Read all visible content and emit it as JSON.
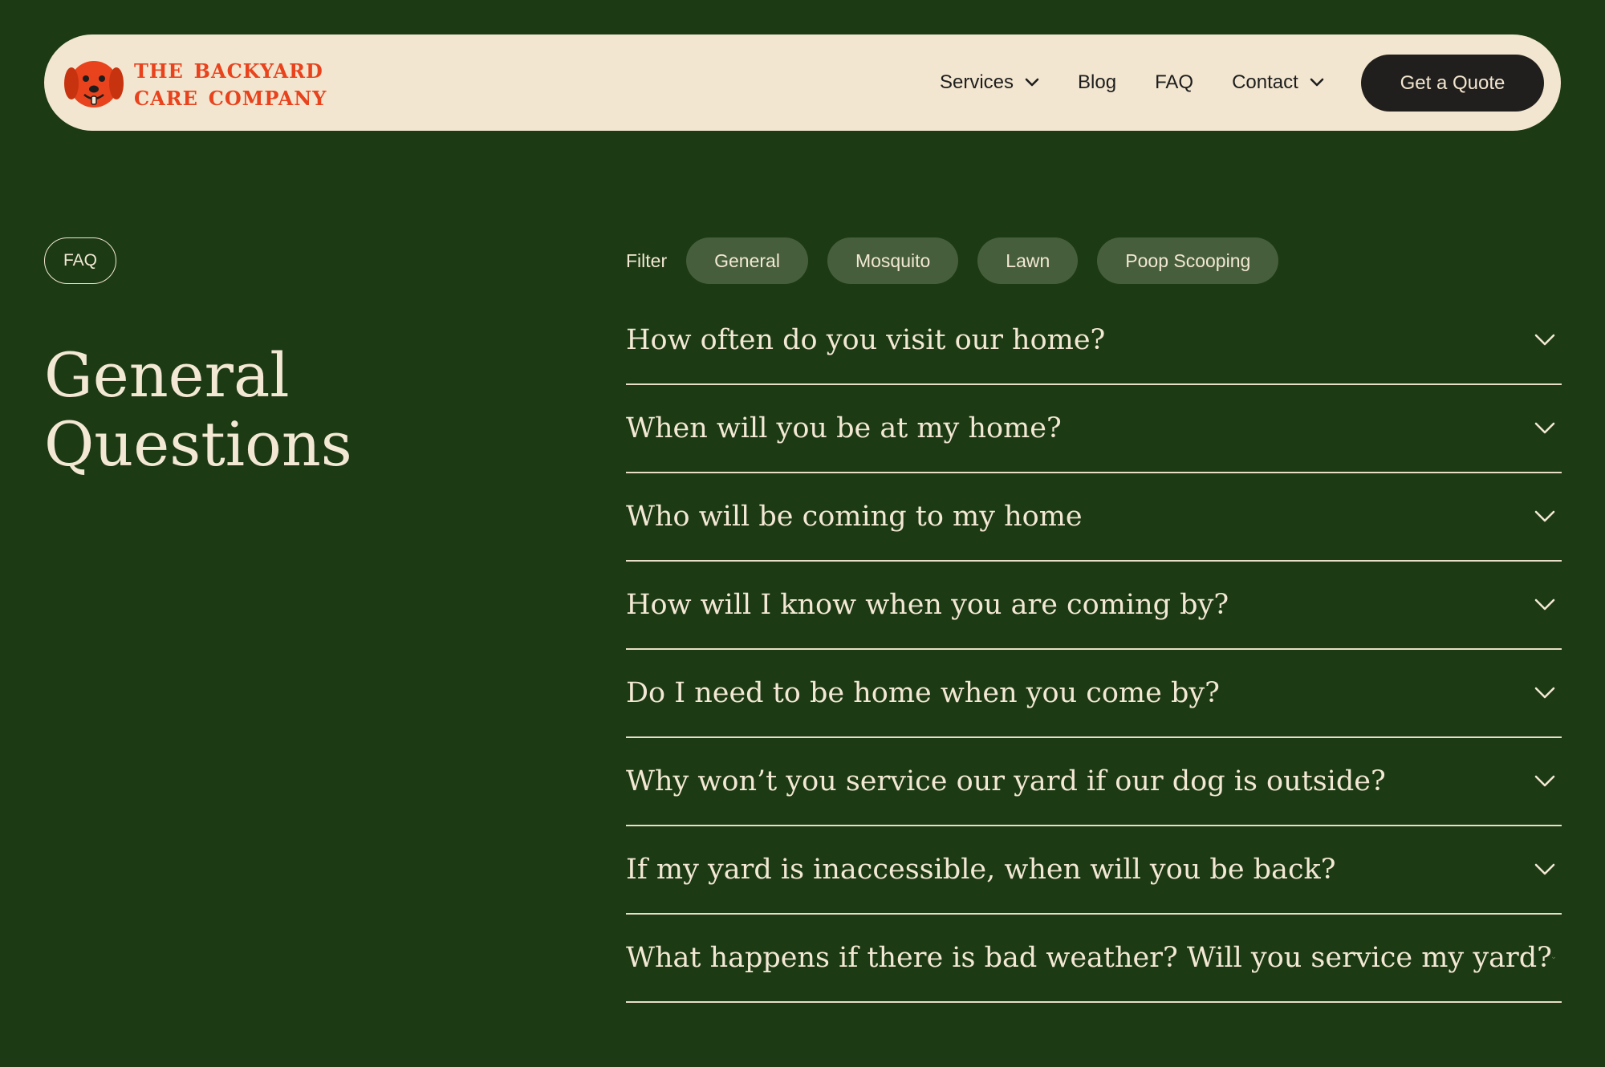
{
  "header": {
    "logo_line1": "The Backyard",
    "logo_line2": "Care Company",
    "nav": [
      {
        "label": "Services",
        "has_dropdown": true
      },
      {
        "label": "Blog",
        "has_dropdown": false
      },
      {
        "label": "FAQ",
        "has_dropdown": false
      },
      {
        "label": "Contact",
        "has_dropdown": true
      }
    ],
    "cta_label": "Get a Quote"
  },
  "section": {
    "tag": "FAQ",
    "title_line1": "General",
    "title_line2": "Questions"
  },
  "filter": {
    "label": "Filter",
    "options": [
      "General",
      "Mosquito",
      "Lawn",
      "Poop Scooping"
    ]
  },
  "faqs": [
    "How often do you visit our home?",
    "When will you be at my home?",
    "Who will be coming to my home",
    "How will I know when you are coming by?",
    "Do I need to be home when you come by?",
    "Why won’t you service our yard if our dog is outside?",
    "If my yard is inaccessible, when will you be back?",
    "What happens if there is bad weather? Will you service my yard?"
  ],
  "colors": {
    "page_bg": "#1c3a14",
    "header_bg": "#f3e6d0",
    "brand_orange": "#e8431d",
    "cta_bg": "#211f1d",
    "chip_bg": "#465e3c",
    "cream_text": "#f3e8d4"
  },
  "icons": {
    "logo": "dog-face-icon",
    "dropdown": "chevron-down-icon",
    "accordion": "chevron-down-icon"
  }
}
